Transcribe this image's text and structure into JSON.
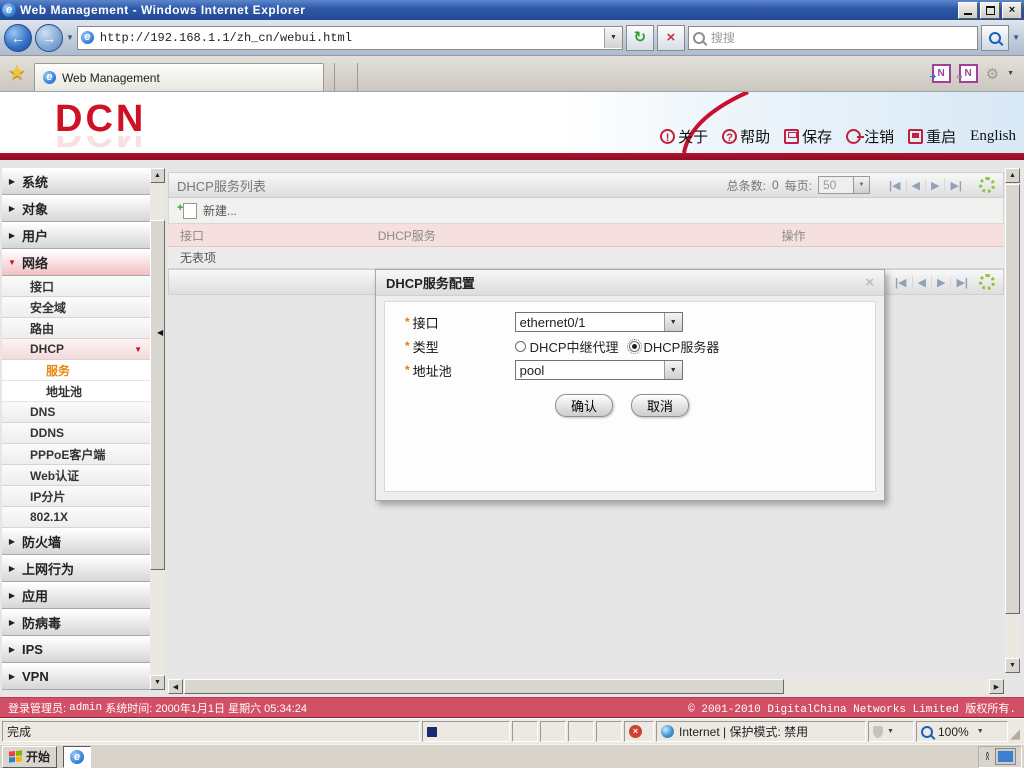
{
  "window": {
    "title": "Web Management - Windows Internet Explorer"
  },
  "browser": {
    "url": "http://192.168.1.1/zh_cn/webui.html",
    "search_placeholder": "搜搜",
    "tab_label": "Web Management"
  },
  "icons": {
    "back": "←",
    "forward": "→",
    "refresh": "↻",
    "stop": "×",
    "dropdown": "▼",
    "star": "★",
    "gear": "⚙",
    "page_first": "|◀",
    "page_prev": "◀",
    "page_next": "▶",
    "page_last": "▶|",
    "up": "▲",
    "down": "▼",
    "left": "◀",
    "right": "▶",
    "collapse_left": "◀",
    "close": "×",
    "onenote": "N",
    "about": "!",
    "help": "?",
    "chevron_up": "∧",
    "grip": "◢"
  },
  "colors": {
    "brand_red": "#cf1126",
    "bar_red": "#d25065",
    "titlebar_blue": "#2d57a7",
    "selected_orange": "#e8860d",
    "required_orange": "#e87a10",
    "refresh_green": "#8cc63f"
  },
  "header": {
    "logo": "DCN",
    "links": [
      {
        "icon": "about-icon",
        "label": "关于"
      },
      {
        "icon": "help-icon",
        "label": "帮助"
      },
      {
        "icon": "save-icon",
        "label": "保存"
      },
      {
        "icon": "logout-icon",
        "label": "注销"
      },
      {
        "icon": "reboot-icon",
        "label": "重启"
      },
      {
        "icon": null,
        "label": "English"
      }
    ]
  },
  "sidebar": {
    "items": [
      {
        "label": "系统",
        "level": 1,
        "state": "collapsed"
      },
      {
        "label": "对象",
        "level": 1,
        "state": "collapsed"
      },
      {
        "label": "用户",
        "level": 1,
        "state": "collapsed"
      },
      {
        "label": "网络",
        "level": 1,
        "state": "expanded",
        "active": true
      },
      {
        "label": "接口",
        "level": 2
      },
      {
        "label": "安全域",
        "level": 2
      },
      {
        "label": "路由",
        "level": 2
      },
      {
        "label": "DHCP",
        "level": 2,
        "state": "expanded"
      },
      {
        "label": "服务",
        "level": 3,
        "selected": true
      },
      {
        "label": "地址池",
        "level": 3
      },
      {
        "label": "DNS",
        "level": 2
      },
      {
        "label": "DDNS",
        "level": 2
      },
      {
        "label": "PPPoE客户端",
        "level": 2
      },
      {
        "label": "Web认证",
        "level": 2
      },
      {
        "label": "IP分片",
        "level": 2
      },
      {
        "label": "802.1X",
        "level": 2
      },
      {
        "label": "防火墙",
        "level": 1,
        "state": "collapsed"
      },
      {
        "label": "上网行为",
        "level": 1,
        "state": "collapsed"
      },
      {
        "label": "应用",
        "level": 1,
        "state": "collapsed"
      },
      {
        "label": "防病毒",
        "level": 1,
        "state": "collapsed"
      },
      {
        "label": "IPS",
        "level": 1,
        "state": "collapsed"
      },
      {
        "label": "VPN",
        "level": 1,
        "state": "collapsed"
      }
    ]
  },
  "main": {
    "list_title": "DHCP服务列表",
    "total_label": "总条数:",
    "total_value": "0",
    "per_page_label": "每页:",
    "per_page_value": "50",
    "new_button": "新建...",
    "table": {
      "headers": [
        "接口",
        "DHCP服务",
        "操作"
      ],
      "empty_text": "无表项"
    }
  },
  "dialog": {
    "title": "DHCP服务配置",
    "required_mark": "*",
    "fields": [
      {
        "label": "接口",
        "type": "select",
        "value": "ethernet0/1"
      },
      {
        "label": "类型",
        "type": "radio",
        "options": [
          {
            "label": "DHCP中继代理",
            "checked": false
          },
          {
            "label": "DHCP服务器",
            "checked": true
          }
        ]
      },
      {
        "label": "地址池",
        "type": "select",
        "value": "pool"
      }
    ],
    "buttons": {
      "ok": "确认",
      "cancel": "取消"
    }
  },
  "footer": {
    "login_label": "登录管理员:",
    "login_user": "admin",
    "time_label": "系统时间:",
    "time_value": "2000年1月1日 星期六 05:34:24",
    "copyright": "© 2001-2010 DigitalChina Networks Limited 版权所有."
  },
  "statusbar": {
    "status": "完成",
    "zone": "Internet",
    "separator": "|",
    "protected_mode": "保护模式: 禁用",
    "zoom": "100%"
  },
  "taskbar": {
    "start_label": "开始"
  }
}
